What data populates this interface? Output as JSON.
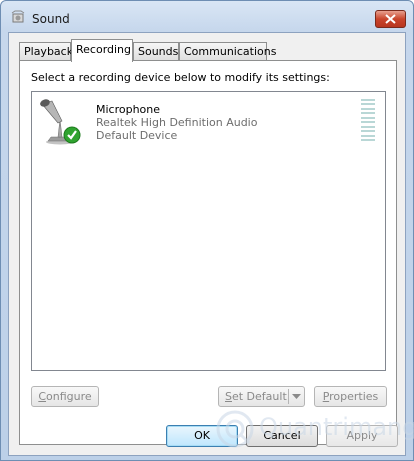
{
  "window": {
    "title": "Sound",
    "close_icon": "close-icon"
  },
  "tabs": [
    {
      "label": "Playback",
      "active": false
    },
    {
      "label": "Recording",
      "active": true
    },
    {
      "label": "Sounds",
      "active": false
    },
    {
      "label": "Communications",
      "active": false
    }
  ],
  "panel": {
    "instruction": "Select a recording device below to modify its settings:"
  },
  "devices": [
    {
      "name": "Microphone",
      "driver": "Realtek High Definition Audio",
      "status": "Default Device",
      "icon": "microphone-icon",
      "badge_icon": "default-check-icon",
      "level_meter_segments": 10
    }
  ],
  "device_buttons": {
    "configure": {
      "prefix": "",
      "accel": "C",
      "rest": "onfigure"
    },
    "set_default": {
      "prefix": "",
      "accel": "S",
      "rest": "et Default"
    },
    "properties": {
      "prefix": "",
      "accel": "P",
      "rest": "roperties"
    }
  },
  "footer": {
    "ok": "OK",
    "cancel": "Cancel",
    "apply": "Apply"
  },
  "watermark": {
    "text": "Quantrimang"
  },
  "colors": {
    "accent_blue": "#3c7fb1",
    "close_red": "#c9452c",
    "check_green": "#2fa32f",
    "disabled_text": "#8a8a8a"
  }
}
